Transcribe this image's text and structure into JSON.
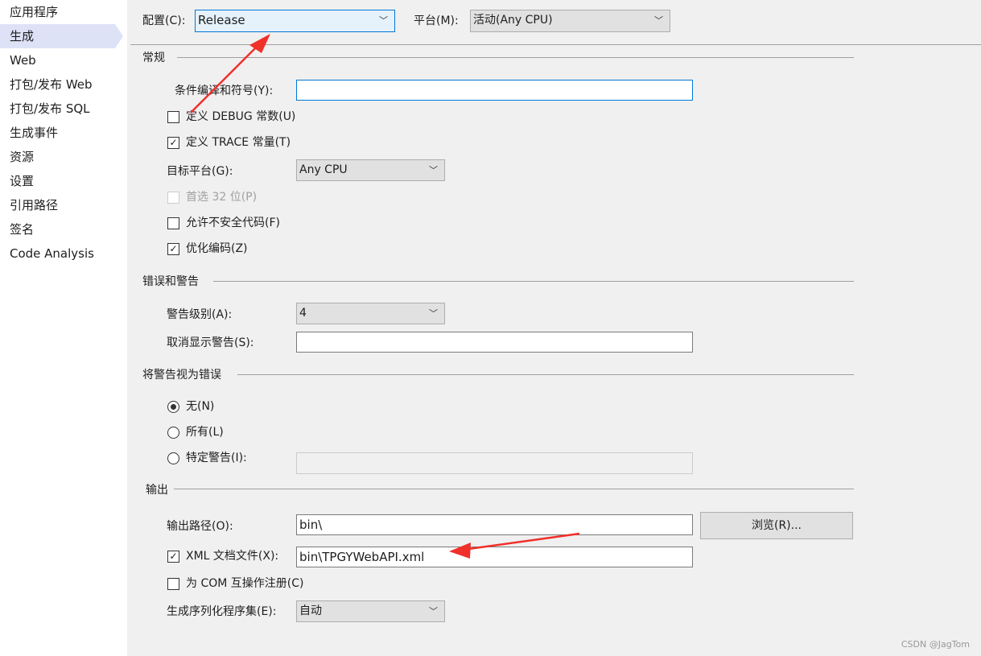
{
  "sidebar": {
    "items": [
      {
        "label": "应用程序"
      },
      {
        "label": "生成",
        "selected": true
      },
      {
        "label": "Web"
      },
      {
        "label": "打包/发布 Web"
      },
      {
        "label": "打包/发布 SQL"
      },
      {
        "label": "生成事件"
      },
      {
        "label": "资源"
      },
      {
        "label": "设置"
      },
      {
        "label": "引用路径"
      },
      {
        "label": "签名"
      },
      {
        "label": "Code Analysis"
      }
    ]
  },
  "config": {
    "label": "配置(C):",
    "value": "Release"
  },
  "platform": {
    "label": "平台(M):",
    "value": "活动(Any CPU)"
  },
  "general": {
    "title": "常规",
    "symbols_label": "条件编译和符号(Y):",
    "symbols_value": "",
    "debug_label": "定义 DEBUG 常数(U)",
    "debug_checked": false,
    "trace_label": "定义 TRACE 常量(T)",
    "trace_checked": true,
    "target_label": "目标平台(G):",
    "target_value": "Any CPU",
    "prefer32_label": "首选 32 位(P)",
    "prefer32_checked": false,
    "unsafe_label": "允许不安全代码(F)",
    "unsafe_checked": false,
    "optimize_label": "优化编码(Z)",
    "optimize_checked": true
  },
  "errors": {
    "title": "错误和警告",
    "level_label": "警告级别(A):",
    "level_value": "4",
    "suppress_label": "取消显示警告(S):",
    "suppress_value": ""
  },
  "treat": {
    "title": "将警告视为错误",
    "none_label": "无(N)",
    "all_label": "所有(L)",
    "specific_label": "特定警告(I):",
    "selected": "none",
    "specific_value": ""
  },
  "output": {
    "title": "输出",
    "path_label": "输出路径(O):",
    "path_value": "bin\\",
    "browse_label": "浏览(R)...",
    "xml_label": "XML 文档文件(X):",
    "xml_checked": true,
    "xml_value": "bin\\TPGYWebAPI.xml",
    "com_label": "为 COM 互操作注册(C)",
    "com_checked": false,
    "serial_label": "生成序列化程序集(E):",
    "serial_value": "自动"
  },
  "annotation_color": "#f0302a",
  "watermark": "CSDN @JagTom"
}
